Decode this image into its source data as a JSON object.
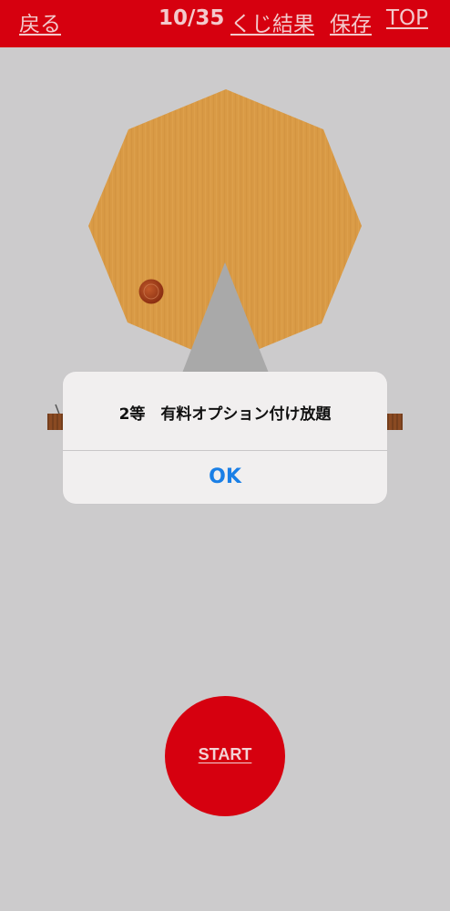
{
  "header": {
    "back_label": "戻る",
    "counter": "10/35",
    "results_label": "くじ結果",
    "save_label": "保存",
    "top_label": "TOP"
  },
  "dialog": {
    "message": "2等　有料オプション付け放題",
    "ok_label": "OK"
  },
  "start_button": {
    "label": "START"
  },
  "colors": {
    "header_bg": "#d6000f",
    "background": "#cccbcc",
    "wheel": "#d99a45",
    "stand": "#a9a9a9",
    "ok_text": "#1a7fe6",
    "ball": "#a3401c"
  }
}
